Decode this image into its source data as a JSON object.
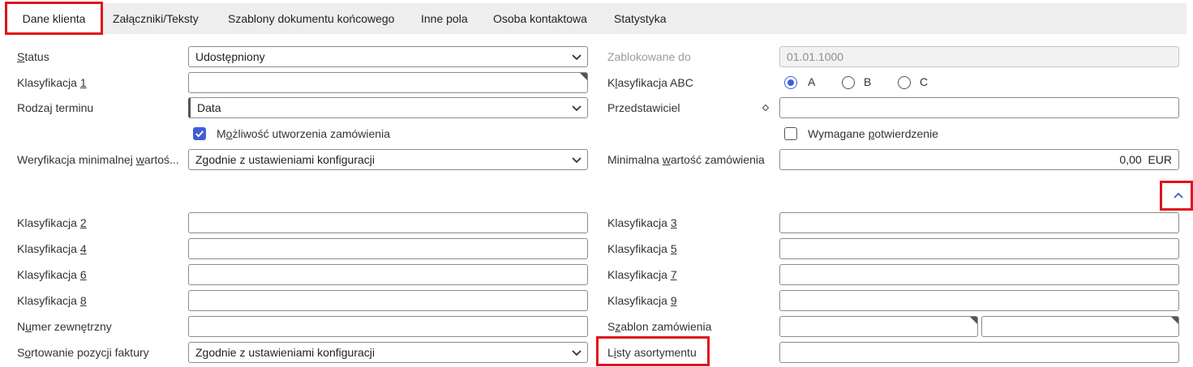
{
  "tabs": [
    "Dane klienta",
    "Załączniki/Teksty",
    "Szablony dokumentu końcowego",
    "Inne pola",
    "Osoba kontaktowa",
    "Statystyka"
  ],
  "left": {
    "status": {
      "pre": "",
      "key": "S",
      "post": "tatus",
      "value": "Udostępniony"
    },
    "klas1": {
      "pre": "Klasyfikacja ",
      "key": "1",
      "post": "",
      "value": ""
    },
    "rodzaj": {
      "pre": "Rodza",
      "key": "j",
      "post": " terminu",
      "value": "Data"
    },
    "mozliwosc": {
      "pre": "M",
      "key": "o",
      "post": "żliwość utworzenia zamówienia",
      "checked": true
    },
    "weryfikacja": {
      "pre": "Weryfikacja minimalnej ",
      "key": "w",
      "post": "artoś...",
      "value": "Zgodnie z ustawieniami konfiguracji"
    },
    "klas2": {
      "pre": "Klasyfikacja ",
      "key": "2",
      "post": "",
      "value": ""
    },
    "klas4": {
      "pre": "Klasyfikacja ",
      "key": "4",
      "post": "",
      "value": ""
    },
    "klas6": {
      "pre": "Klasyfikacja ",
      "key": "6",
      "post": "",
      "value": ""
    },
    "klas8": {
      "pre": "Klasyfikacja ",
      "key": "8",
      "post": "",
      "value": ""
    },
    "numer": {
      "pre": "N",
      "key": "u",
      "post": "mer zewnętrzny",
      "value": ""
    },
    "sortowanie": {
      "pre": "S",
      "key": "o",
      "post": "rtowanie pozycji faktury",
      "value": "Zgodnie z ustawieniami konfiguracji"
    }
  },
  "right": {
    "zablokowane": {
      "label": "Zablokowane do",
      "value": "01.01.1000"
    },
    "abc": {
      "pre": "K",
      "key": "l",
      "post": "asyfikacja ABC",
      "options": [
        "A",
        "B",
        "C"
      ],
      "selected": "A"
    },
    "przedstawiciel": {
      "label": "Przedstawiciel",
      "value": ""
    },
    "wymagane": {
      "pre": "Wymagane ",
      "key": "p",
      "post": "otwierdzenie",
      "checked": false
    },
    "minimalna": {
      "pre": "Minimalna ",
      "key": "w",
      "post": "artość zamówienia",
      "value": "0,00",
      "currency": "EUR"
    },
    "klas3": {
      "pre": "Klasyfikacja ",
      "key": "3",
      "post": "",
      "value": ""
    },
    "klas5": {
      "pre": "Klasyfikacja ",
      "key": "5",
      "post": "",
      "value": ""
    },
    "klas7": {
      "pre": "Klasyfikacja ",
      "key": "7",
      "post": "",
      "value": ""
    },
    "klas9": {
      "pre": "Klasyfikacja ",
      "key": "9",
      "post": "",
      "value": ""
    },
    "szablon": {
      "pre": "S",
      "key": "z",
      "post": "ablon zamówienia",
      "value1": "",
      "value2": ""
    },
    "listy": {
      "pre": "L",
      "key": "i",
      "post": "sty asortymentu",
      "value": ""
    }
  },
  "colors": {
    "accent": "#3e5fd6",
    "highlight": "#e0121b",
    "tabbar": "#eeeeee"
  }
}
